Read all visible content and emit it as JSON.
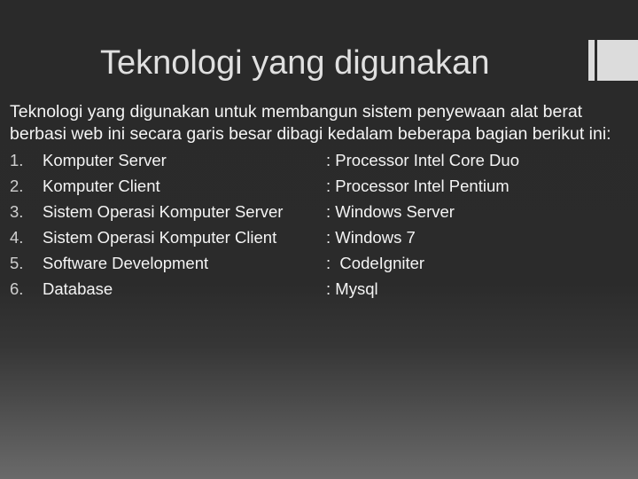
{
  "slide": {
    "title": "Teknologi yang digunakan",
    "intro_line1": "Teknologi yang digunakan untuk membangun sistem penyewaan alat berat",
    "intro_line2": "berbasi web ini secara garis besar dibagi kedalam beberapa bagian berikut ini:",
    "items": [
      {
        "num": "1.",
        "name": "Komputer Server",
        "value": ": Processor Intel Core Duo"
      },
      {
        "num": "2.",
        "name": "Komputer Client",
        "value": ": Processor Intel Pentium"
      },
      {
        "num": "3.",
        "name": "Sistem Operasi Komputer Server",
        "value": ": Windows Server"
      },
      {
        "num": "4.",
        "name": "Sistem Operasi Komputer Client",
        "value": ": Windows 7"
      },
      {
        "num": "5.",
        "name": "Software Development",
        "value": ":  CodeIgniter"
      },
      {
        "num": "6.",
        "name": "Database",
        "value": ": Mysql"
      }
    ]
  },
  "colors": {
    "background_top": "#2a2a2a",
    "background_bottom": "#6a6a6a",
    "title_text": "#e0e0e0",
    "body_text": "#f4f4f4",
    "decoration": "#dcdcdc"
  }
}
